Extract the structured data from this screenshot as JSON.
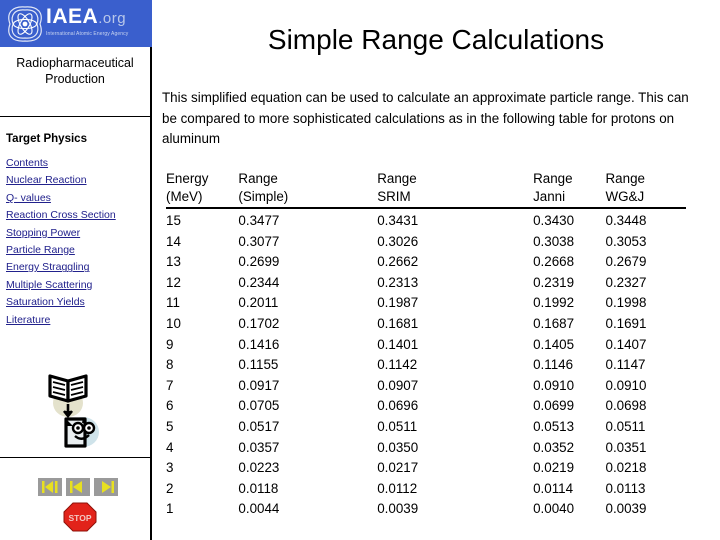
{
  "logo": {
    "main_text": "IAEA",
    "domain_text": ".org",
    "subtitle": "International Atomic Energy Agency",
    "banner_color": "#3a5fcd",
    "icon_name": "atom-wreath-icon"
  },
  "sidebar": {
    "heading": "Radiopharmaceutical Production",
    "section_title": "Target Physics",
    "nav_items": [
      {
        "label": "Contents"
      },
      {
        "label": "Nuclear Reaction"
      },
      {
        "label": "Q- values"
      },
      {
        "label": "Reaction Cross Section"
      },
      {
        "label": "Stopping Power"
      },
      {
        "label": "Particle Range"
      },
      {
        "label": "Energy Straggling"
      },
      {
        "label": "Multiple Scattering"
      },
      {
        "label": "Saturation Yields"
      },
      {
        "label": "Literature"
      }
    ],
    "link_color": "#21218c",
    "book_icon_name": "book-to-document-icon",
    "nav_buttons": [
      {
        "name": "first-slide-button",
        "glyph": "first"
      },
      {
        "name": "previous-slide-button",
        "glyph": "previous"
      },
      {
        "name": "next-slide-button",
        "glyph": "next"
      }
    ],
    "stop_button_label": "STOP",
    "stop_button_color": "#e2231a"
  },
  "main": {
    "title": "Simple Range Calculations",
    "paragraph": "This simplified equation can be used to calculate an approximate particle range.  This can be compared to more sophisticated calculations as in the following table for protons on aluminum"
  },
  "table": {
    "headers_top": [
      "Energy",
      "Range",
      "Range",
      "Range",
      "Range"
    ],
    "headers_bottom": [
      "(MeV)",
      "(Simple)",
      "SRIM",
      "Janni",
      "WG&J"
    ],
    "rows": [
      [
        "15",
        "0.3477",
        "0.3431",
        "0.3430",
        "0.3448"
      ],
      [
        "14",
        "0.3077",
        "0.3026",
        "0.3038",
        "0.3053"
      ],
      [
        "13",
        "0.2699",
        "0.2662",
        "0.2668",
        "0.2679"
      ],
      [
        "12",
        "0.2344",
        "0.2313",
        "0.2319",
        "0.2327"
      ],
      [
        "11",
        "0.2011",
        "0.1987",
        "0.1992",
        "0.1998"
      ],
      [
        "10",
        "0.1702",
        "0.1681",
        "0.1687",
        "0.1691"
      ],
      [
        "9",
        "0.1416",
        "0.1401",
        "0.1405",
        "0.1407"
      ],
      [
        "8",
        "0.1155",
        "0.1142",
        "0.1146",
        "0.1147"
      ],
      [
        "7",
        "0.0917",
        "0.0907",
        "0.0910",
        "0.0910"
      ],
      [
        "6",
        "0.0705",
        "0.0696",
        "0.0699",
        "0.0698"
      ],
      [
        "5",
        "0.0517",
        "0.0511",
        "0.0513",
        "0.0511"
      ],
      [
        "4",
        "0.0357",
        "0.0350",
        "0.0352",
        "0.0351"
      ],
      [
        "3",
        "0.0223",
        "0.0217",
        "0.0219",
        "0.0218"
      ],
      [
        "2",
        "0.0118",
        "0.0112",
        "0.0114",
        "0.0113"
      ],
      [
        "1",
        "0.0044",
        "0.0039",
        "0.0040",
        "0.0039"
      ]
    ]
  }
}
